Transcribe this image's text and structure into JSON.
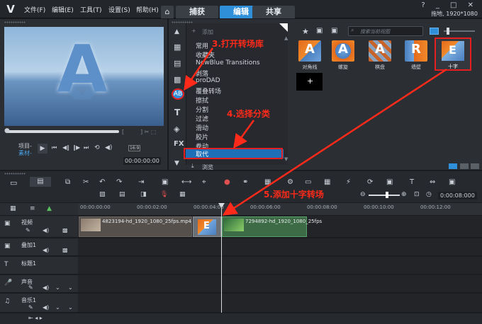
{
  "app": {
    "menu": [
      "文件(F)",
      "编辑(E)",
      "工具(T)",
      "设置(S)",
      "帮助(H)"
    ],
    "tabs": [
      "捕获",
      "编辑",
      "共享"
    ],
    "active_tab": "编辑",
    "resolution": "拖地, 1920*1080"
  },
  "preview": {
    "letter": "A",
    "mode_project": "项目-",
    "mode_clip": "素材-",
    "timecode": "00:00:00:00",
    "ratio": "16:9"
  },
  "library": {
    "add_label": "添加",
    "search_placeholder": "搜索当前视图",
    "categories": [
      "常用",
      "收藏夹",
      "NewBlue Transitions",
      "剥落",
      "proDAD",
      "覆叠转场",
      "擦拭",
      "分割",
      "过滤",
      "滑动",
      "胶片",
      "卷动",
      "取代"
    ],
    "selected_category": "取代",
    "browse_label": "浏览",
    "thumbnails": [
      "对角线",
      "螺旋",
      "棋盘",
      "墙壁",
      "十字"
    ],
    "selected_thumbnail": "十字"
  },
  "annotations": {
    "step3": "3.打开转场库",
    "step4": "4.选择分类",
    "step5": "5.添加十字转场"
  },
  "timeline": {
    "ticks": [
      "00:00:00:00",
      "00:00:02:00",
      "00:00:04:00",
      "00:00:06:00",
      "00:00:08:00",
      "00:00:10:00",
      "00:00:12:00"
    ],
    "zoom_time": "0:00:08:000",
    "tracks": [
      "视频",
      "叠加1",
      "标题1",
      "声音",
      "音乐1"
    ],
    "clip1": "4823194-hd_1920_1080_25fps.mp4",
    "clip2": "7294892-hd_1920_1080_25fps"
  }
}
